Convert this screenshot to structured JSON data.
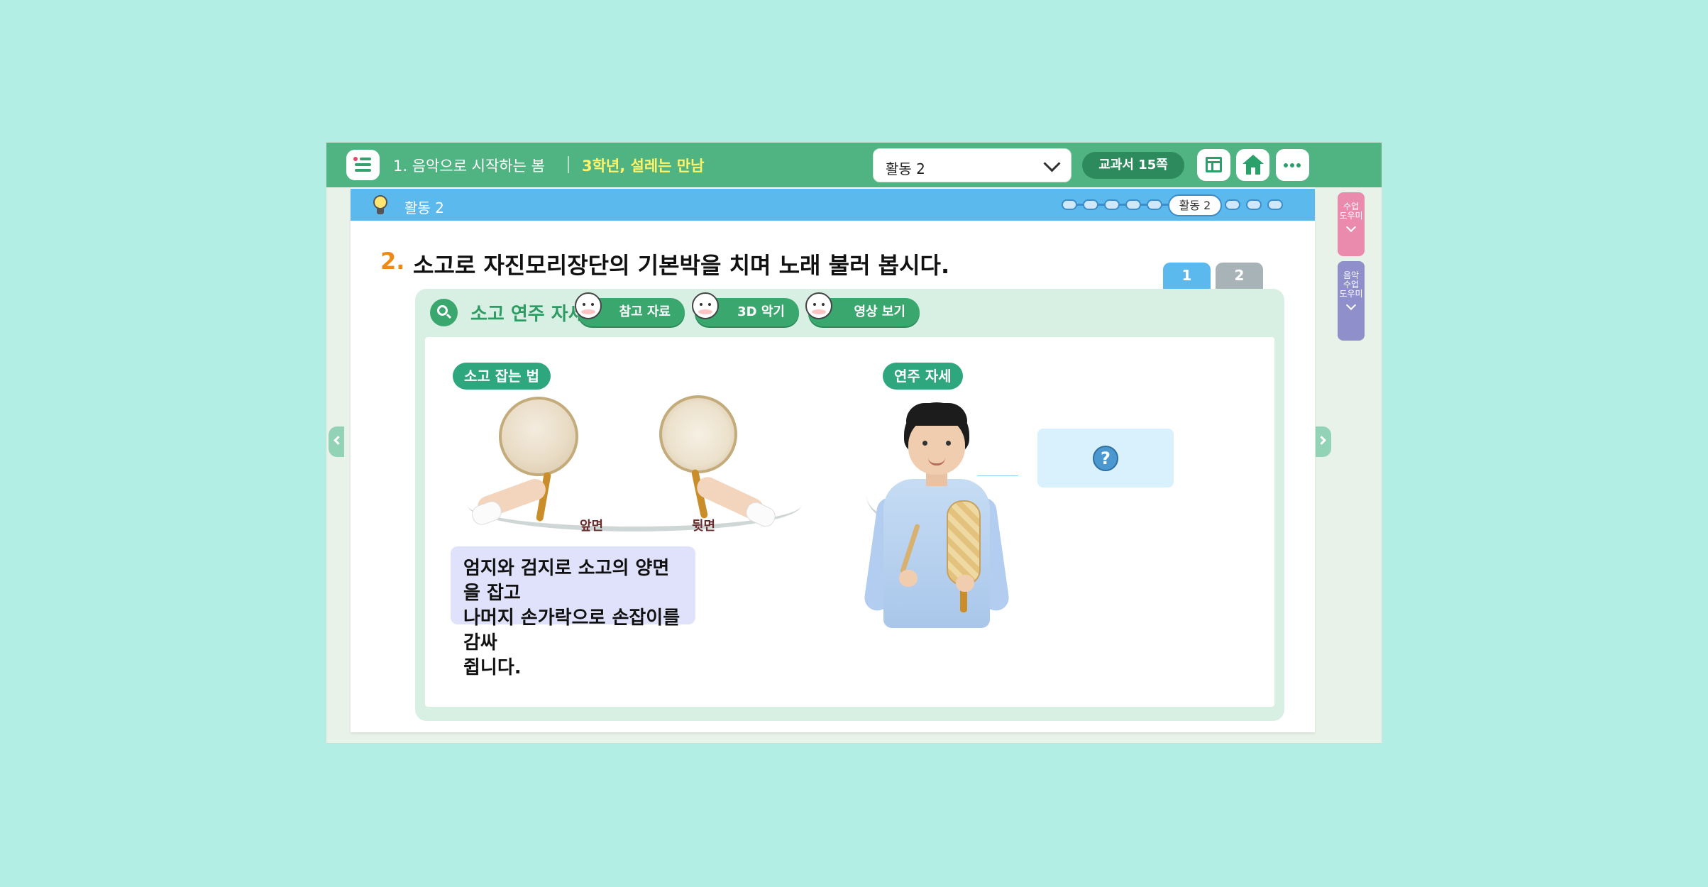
{
  "header": {
    "unit_title": "1. 음악으로 시작하는 봄",
    "lesson_title": "3학년, 설레는 만남",
    "activity_select": {
      "value": "활동 2"
    },
    "textbook_page": "교과서 15쪽",
    "icons": [
      "menu-icon",
      "layout-icon",
      "home-icon",
      "more-icon"
    ]
  },
  "subheader": {
    "label": "활동 2",
    "progress": {
      "current_label": "활동 2",
      "total_steps": 9,
      "current_index": 6
    }
  },
  "question": {
    "number": "2.",
    "text": "소고로 자진모리장단의 기본박을 치며 노래 불러 봅시다."
  },
  "page_tabs": [
    "1",
    "2"
  ],
  "card": {
    "title": "소고 연주 자세 알아보기",
    "buttons": {
      "reference": "참고 자료",
      "model_3d": "3D 악기",
      "video": "영상 보기"
    },
    "hold_tag": "소고 잡는 법",
    "front_label": "앞면",
    "back_label": "뒷면",
    "description": "엄지와 검지로 소고의 양면을 잡고\n나머지 손가락으로 손잡이를 감싸\n쥡니다.",
    "posture_tag": "연주 자세",
    "answer_placeholder": "?"
  },
  "side_tools": {
    "class_helper": "수업\n도우미",
    "music_helper": "음악\n수업\n도우미"
  },
  "colors": {
    "background": "#b2eee3",
    "topbar": "#4fb482",
    "subbar": "#5bb9ee",
    "accent_orange": "#f08a16",
    "lesson_yellow": "#fff36a"
  }
}
